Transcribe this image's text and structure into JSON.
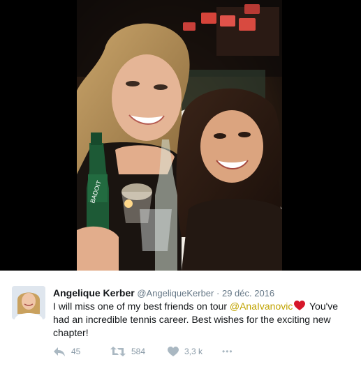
{
  "tweet": {
    "author_name": "Angelique Kerber",
    "author_handle": "@AngeliqueKerber",
    "separator": "·",
    "date": "29 déc. 2016",
    "text_part1": "I will miss one of my best friends on tour ",
    "mention": "@AnaIvanovic",
    "text_part2": " You've had an incredible tennis career. Best wishes for the exciting new chapter!",
    "mention_color": "#c0a300",
    "emoji": "red-heart"
  },
  "media": {
    "bottle_label": "BADOIT"
  },
  "actions": {
    "reply_icon": "reply-icon",
    "reply_count": "45",
    "retweet_icon": "retweet-icon",
    "retweet_count": "584",
    "like_icon": "heart-icon",
    "like_count": "3,3 k",
    "more_icon": "more-icon",
    "more_label": "•••"
  },
  "colors": {
    "name": "#14171a",
    "secondary": "#657786",
    "icon": "#aab8c2",
    "heart": "#e0245e"
  }
}
